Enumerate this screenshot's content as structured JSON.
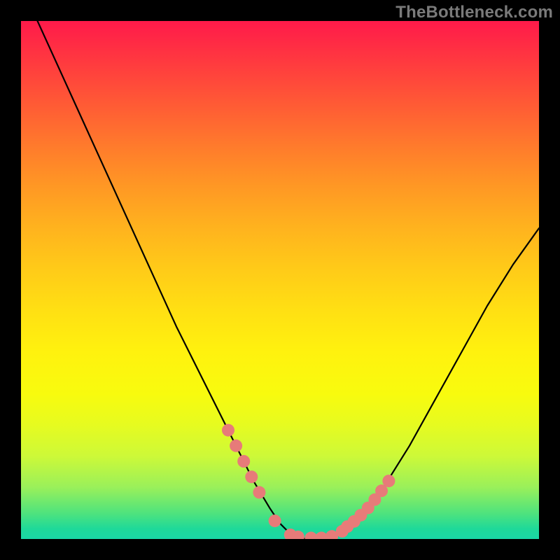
{
  "watermark": "TheBottleneck.com",
  "chart_data": {
    "type": "line",
    "title": "",
    "xlabel": "",
    "ylabel": "",
    "xlim": [
      0,
      100
    ],
    "ylim": [
      0,
      100
    ],
    "grid": false,
    "legend": false,
    "series": [
      {
        "name": "curve",
        "x": [
          0,
          5,
          10,
          15,
          20,
          25,
          30,
          35,
          40,
          45,
          48,
          50,
          52,
          55,
          58,
          60,
          62,
          65,
          70,
          75,
          80,
          85,
          90,
          95,
          100
        ],
        "y": [
          107,
          96,
          85,
          74,
          63,
          52,
          41,
          31,
          21,
          11,
          6,
          3,
          1,
          0,
          0,
          0.5,
          1.5,
          4,
          10,
          18,
          27,
          36,
          45,
          53,
          60
        ]
      }
    ],
    "markers": {
      "name": "dots",
      "x": [
        40,
        41.5,
        43,
        44.5,
        46,
        49,
        52,
        53.5,
        56,
        58,
        60,
        62,
        63,
        64.3,
        65.6,
        67,
        68.3,
        69.6,
        71
      ],
      "y": [
        21,
        18,
        15,
        12,
        9,
        3.5,
        0.8,
        0.4,
        0.2,
        0.2,
        0.5,
        1.5,
        2.4,
        3.4,
        4.6,
        6,
        7.6,
        9.3,
        11.2
      ]
    },
    "colors": {
      "curve_stroke": "#000000",
      "marker_fill": "#e77b79",
      "gradient_top": "#ff1a4a",
      "gradient_bottom": "#1ad7a6"
    }
  }
}
